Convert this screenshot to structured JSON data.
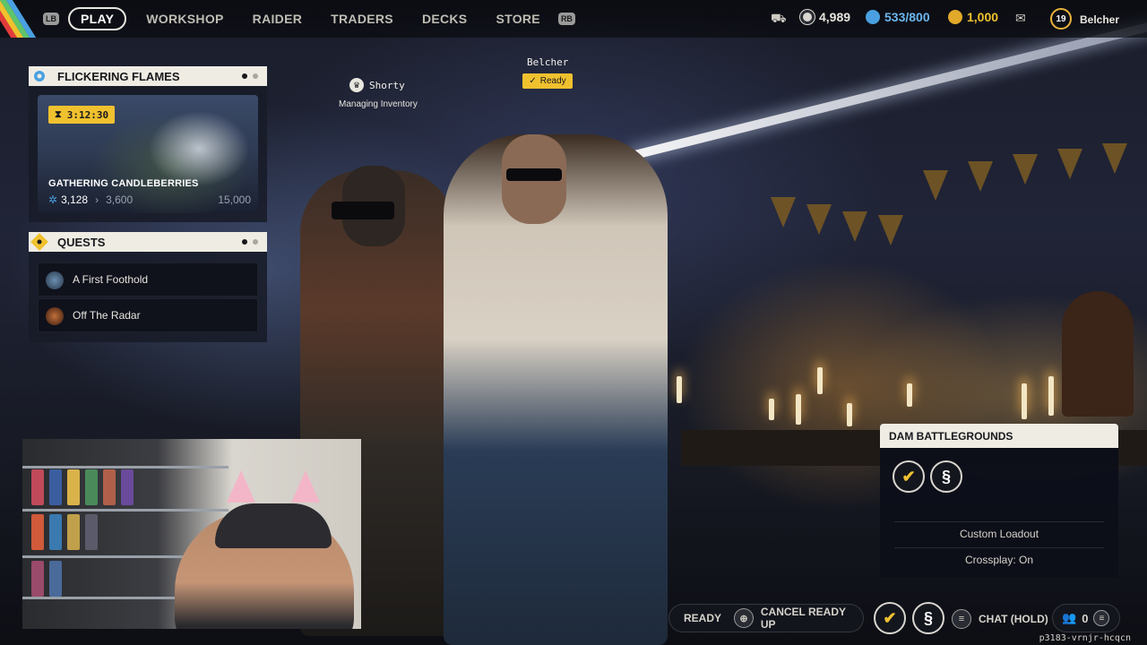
{
  "nav": {
    "lb": "LB",
    "rb": "RB",
    "items": [
      "PLAY",
      "WORKSHOP",
      "RAIDER",
      "TRADERS",
      "DECKS",
      "STORE"
    ],
    "active": "PLAY"
  },
  "currencies": {
    "coins": "4,989",
    "tokens": "533/800",
    "credits": "1,000"
  },
  "player": {
    "level": "19",
    "name": "Belcher"
  },
  "event": {
    "title": "FLICKERING FLAMES",
    "timer": "3:12:30",
    "name": "GATHERING CANDLEBERRIES",
    "progress_current": "3,128",
    "progress_next": "3,600",
    "progress_max": "15,000"
  },
  "quests": {
    "title": "QUESTS",
    "items": [
      "A First Foothold",
      "Off The Radar"
    ]
  },
  "squad": {
    "member1_name": "Shorty",
    "member1_status": "Managing Inventory",
    "member2_name": "Belcher",
    "member2_status": "Ready"
  },
  "mode": {
    "title": "DAM BATTLEGROUNDS",
    "loadout": "Custom Loadout",
    "crossplay": "Crossplay: On"
  },
  "bottom": {
    "ready": "READY",
    "cancel": "CANCEL READY UP",
    "chat": "CHAT (HOLD)",
    "party_count": "0",
    "session_id": "p3183-vrnjr-hcqcn"
  },
  "icons": {
    "coins": "shield-coin-icon",
    "tokens": "token-icon",
    "credits": "credits-icon",
    "mail": "mail-icon"
  },
  "colors": {
    "accent": "#f0c12f",
    "panel_header": "#efece4",
    "token_blue": "#4aa0e0"
  }
}
